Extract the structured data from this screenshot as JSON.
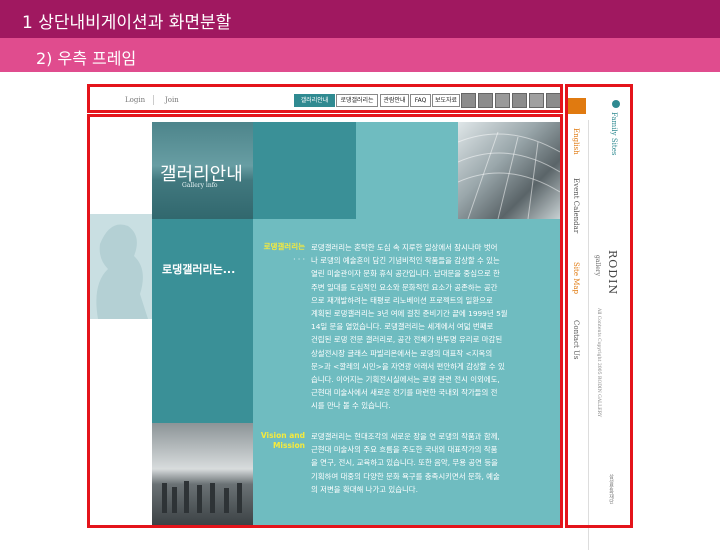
{
  "slide": {
    "title": "1 상단내비게이션과 화면분할",
    "subtitle": "2) 우측 프레임"
  },
  "topnav": {
    "login": "Login",
    "join": "Join",
    "buttons": [
      "갤러리안내",
      "로댕갤러리는",
      "관람안내",
      "FAQ",
      "보도자료"
    ],
    "active_index": 0,
    "icons": [
      "nav-thumb-1-icon",
      "nav-thumb-2-icon",
      "nav-thumb-3-icon",
      "nav-thumb-4-icon",
      "nav-thumb-5-icon",
      "nav-thumb-6-icon"
    ]
  },
  "hero": {
    "title": "갤러리안내",
    "subtitle": "Gallery info"
  },
  "section": {
    "heading": "로댕갤러리는...",
    "label1": "로댕갤러리는",
    "label1_dots": "· · ·",
    "body1": [
      "로댕갤러리는 혼탁한 도심 속 지루한 일상에서 잠시나마 벗어",
      "나 로댕의 예술혼이 담긴 기념비적인 작품들을 감상할 수 있는",
      "열린 미술관이자 문화 휴식 공간입니다. 남대문을 중심으로 한",
      "주변 일대를 도심적인 요소와 문화적인 요소가 공존하는 공간",
      "으로 재개발하려는 태평로 리노베이션 프로젝트의 일환으로",
      "계획된 로댕갤러리는 3년 여에 걸친 준비기간 끝에 1999년 5월",
      "14일 문을 열었습니다. 로댕갤러리는 세계에서 여덟 번째로",
      "건립된 로댕 전문 갤러리로, 공간 전체가 반투명 유리로 마감된",
      "상설전시장 글래스 파빌리온에서는 로댕의 대표작 <지옥의",
      "문>과 <깔레의 시민>을 자연광 아래서 편안하게 감상할 수 있",
      "습니다. 이어지는 기획전시실에서는 로댕 관련 전시 이외에도,",
      "근현대 미술사에서 새로운 전기를 마련한 국내외 작가들의 전",
      "시를 만나 볼 수 있습니다."
    ],
    "label2": "Vision and Mission",
    "body2": [
      "로댕갤러리는 현대조각의 새로운 장을 연 로댕의 작품과 함께,",
      "근현대 미술사의 주요 흐름을 주도한 국내외 대표작가의 작품",
      "을 연구, 전시, 교육하고 있습니다. 또한 음악, 무용 공연 등을",
      "기획하여 대중의 다양한 문화 욕구를 충족시키면서 문화, 예술",
      "의 저변을 확대해 나가고 있습니다."
    ]
  },
  "side": {
    "family_sites": "Family Sites",
    "links": [
      "English",
      "Event Calendar",
      "Site Map",
      "Contact Us"
    ],
    "logo": "RODIN",
    "logo_sub": "gallery",
    "copyright": "All Contents Copyright 2005 RODIN GALLERY",
    "footer": "삼성문화재단"
  },
  "colors": {
    "frame": "#e4141b",
    "header_dark": "#a01860",
    "header_light": "#e04c8e",
    "teal_dark": "#2b7c84",
    "teal_mid": "#3a9097",
    "teal_light": "#6fbcc0",
    "accent_yellow": "#f6ea3c",
    "side_link": "#e07a10"
  }
}
